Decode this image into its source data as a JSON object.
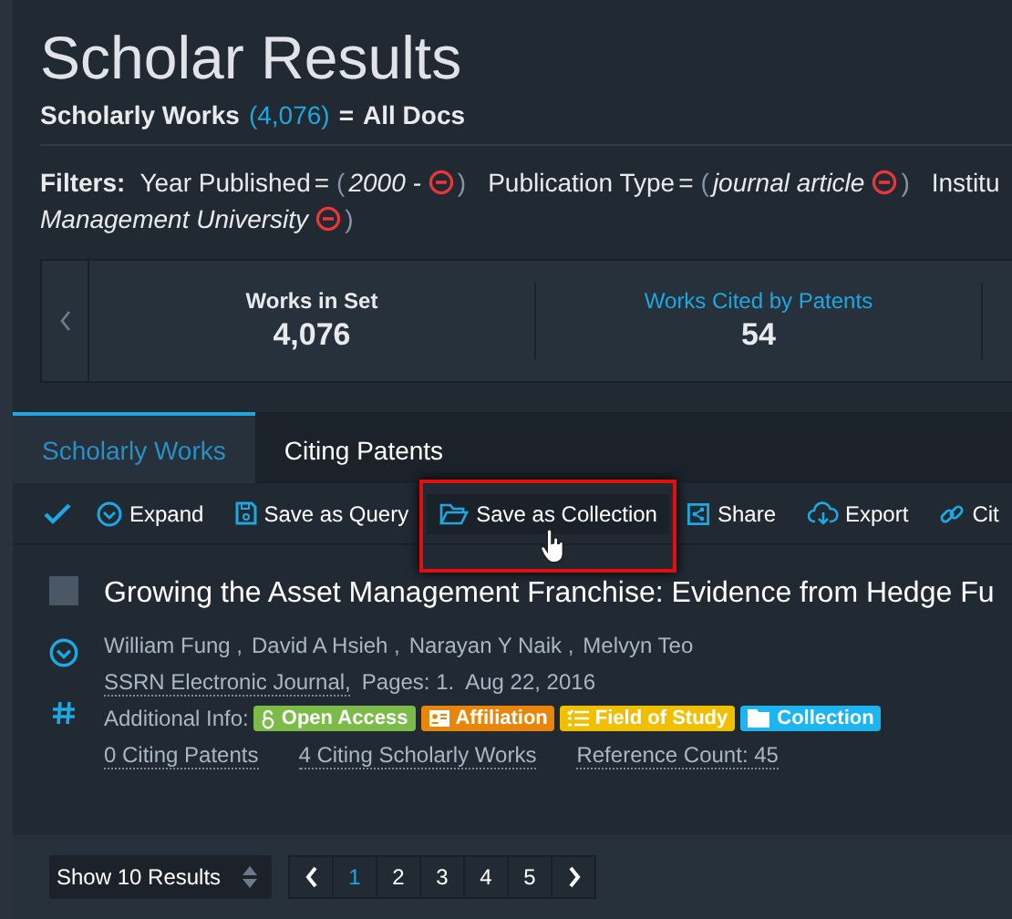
{
  "page": {
    "title": "Scholar Results"
  },
  "query": {
    "label": "Scholarly Works",
    "count": "(4,076)",
    "equals": "=",
    "value": "All Docs"
  },
  "filters": {
    "label": "Filters:",
    "items": [
      {
        "field": "Year Published",
        "op": "=",
        "open": "(",
        "value": "2000 -",
        "close": ")"
      },
      {
        "field": "Publication Type",
        "op": "=",
        "open": "(",
        "value": "journal article",
        "close": ")"
      },
      {
        "field": "Institu",
        "value": "Management University",
        "close": ")"
      }
    ]
  },
  "stats": [
    {
      "label": "Works in Set",
      "value": "4,076",
      "link": false
    },
    {
      "label": "Works Cited by Patents",
      "value": "54",
      "link": true
    }
  ],
  "tabs": [
    {
      "label": "Scholarly Works",
      "selected": true
    },
    {
      "label": "Citing Patents",
      "selected": false
    }
  ],
  "toolbar": {
    "select_all": {
      "checked": true
    },
    "actions": [
      {
        "kind": "expand",
        "label": "Expand",
        "hovered": false,
        "highlighted": false
      },
      {
        "kind": "query",
        "label": "Save as Query",
        "hovered": false,
        "highlighted": false
      },
      {
        "kind": "collection",
        "label": "Save as Collection",
        "hovered": true,
        "highlighted": true
      },
      {
        "kind": "share",
        "label": "Share",
        "hovered": false,
        "highlighted": false
      },
      {
        "kind": "export",
        "label": "Export",
        "hovered": false,
        "highlighted": false
      },
      {
        "kind": "cite",
        "label": "Cit",
        "hovered": false,
        "highlighted": false
      }
    ]
  },
  "result": {
    "checked": false,
    "title": "Growing the Asset Management Franchise: Evidence from Hedge Fu",
    "authors": [
      "William Fung ,",
      "David A Hsieh ,",
      "Narayan Y Naik ,",
      "Melvyn Teo"
    ],
    "source": "SSRN Electronic Journal,",
    "pages": "Pages: 1.",
    "date": "Aug 22, 2016",
    "info_label": "Additional Info:",
    "tags": [
      {
        "kind": "open-access",
        "label": "Open Access",
        "color": "#7cba4a"
      },
      {
        "kind": "affiliation",
        "label": "Affiliation",
        "color": "#e8860c"
      },
      {
        "kind": "field",
        "label": "Field of Study",
        "color": "#f0c000"
      },
      {
        "kind": "collection",
        "label": "Collection",
        "color": "#1eb4f0"
      }
    ],
    "metrics": [
      "0 Citing Patents",
      "4 Citing Scholarly Works",
      "Reference Count: 45"
    ]
  },
  "footer": {
    "page_size": "Show 10 Results",
    "pages": [
      {
        "label": "1",
        "selected": true
      },
      {
        "label": "2",
        "selected": false
      },
      {
        "label": "3",
        "selected": false
      },
      {
        "label": "4",
        "selected": false
      },
      {
        "label": "5",
        "selected": false
      }
    ]
  }
}
